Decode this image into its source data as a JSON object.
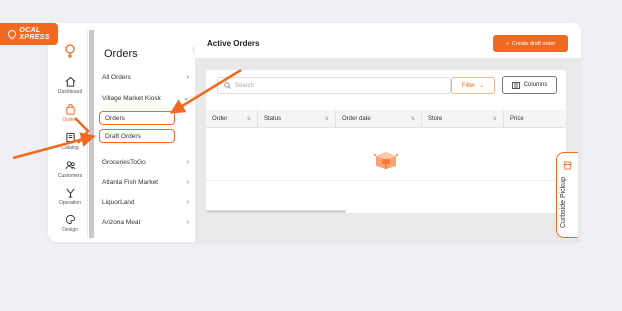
{
  "brand": {
    "logo_line1": "OCAL",
    "logo_line2": "XPRESS",
    "accent": "#f26a22"
  },
  "rail": {
    "items": [
      {
        "label": "Dashboard",
        "icon": "home-icon"
      },
      {
        "label": "Orders",
        "icon": "bag-icon",
        "active": true
      },
      {
        "label": "Catalog",
        "icon": "book-icon"
      },
      {
        "label": "Customers",
        "icon": "users-icon"
      },
      {
        "label": "Operation",
        "icon": "fork-icon"
      },
      {
        "label": "Design",
        "icon": "palette-icon"
      }
    ]
  },
  "sub": {
    "title": "Orders",
    "items": [
      {
        "label": "All Orders",
        "chev": ">"
      },
      {
        "label": "Village Market Kiosk",
        "chev": "v"
      },
      {
        "label": "Orders",
        "chev": ""
      },
      {
        "label": "Draft Orders",
        "chev": ""
      },
      {
        "label": "GroceriesToGo",
        "chev": ">"
      },
      {
        "label": "Atlanta Fish Market",
        "chev": ">"
      },
      {
        "label": "LiquorLand",
        "chev": ">"
      },
      {
        "label": "Arizona Meat",
        "chev": ">"
      }
    ]
  },
  "main": {
    "title": "Active Orders",
    "create_label": "Create draft order",
    "search_placeholder": "Search",
    "filter_label": "Filter",
    "columns_label": "Columns",
    "columns": [
      "Order",
      "Status",
      "Order date",
      "Store",
      "Price"
    ]
  },
  "curbside": {
    "label": "Curbside Pickup"
  }
}
